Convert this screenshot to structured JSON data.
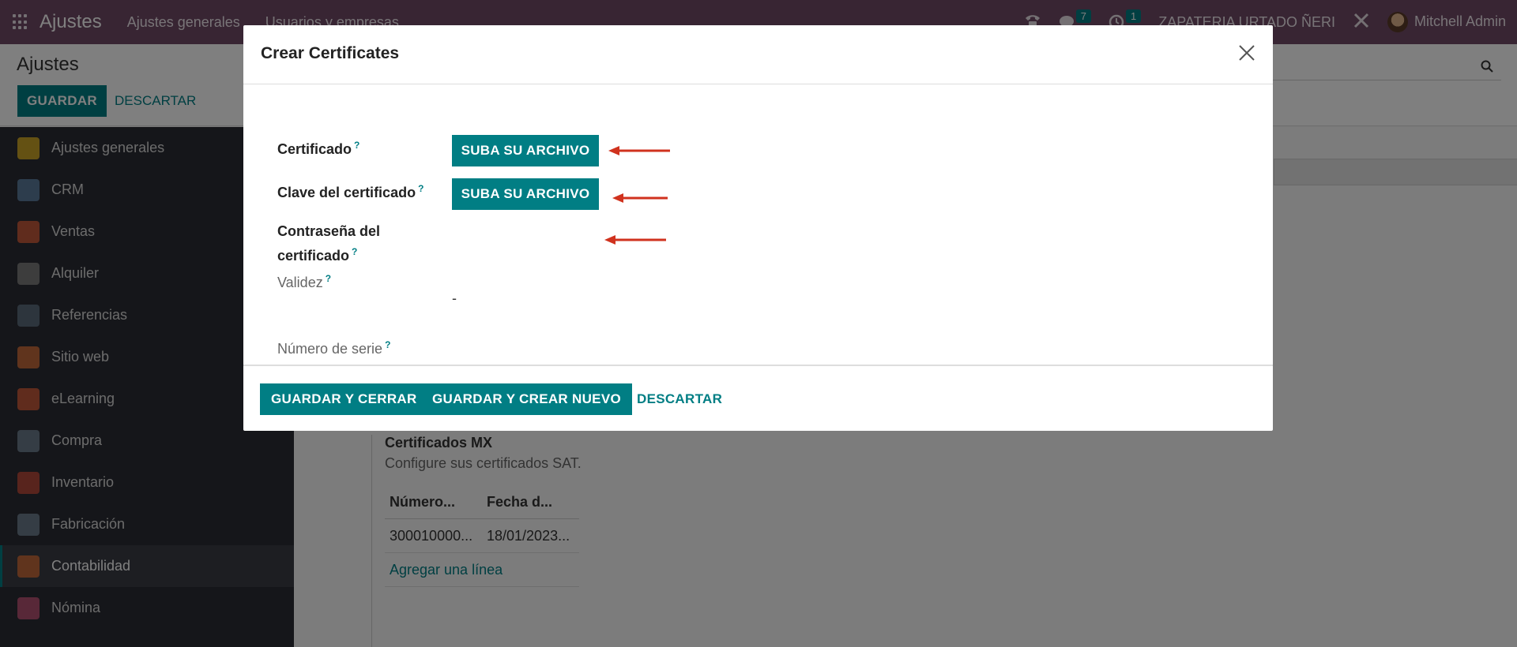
{
  "navbar": {
    "app_name": "Ajustes",
    "menu": [
      "Ajustes generales",
      "Usuarios y empresas"
    ],
    "messages_count": "7",
    "activities_count": "1",
    "company": "ZAPATERIA URTADO ÑERI",
    "user": "Mitchell Admin"
  },
  "control_panel": {
    "title": "Ajustes",
    "save_label": "GUARDAR",
    "discard_label": "DESCARTAR"
  },
  "sidebar": {
    "items": [
      {
        "label": "Ajustes generales",
        "icon": "gear-icon",
        "color": "#c9a227"
      },
      {
        "label": "CRM",
        "icon": "handshake-icon",
        "color": "#5a7a9a"
      },
      {
        "label": "Ventas",
        "icon": "chart-icon",
        "color": "#c0583a"
      },
      {
        "label": "Alquiler",
        "icon": "rental-icon",
        "color": "#7a7a7a"
      },
      {
        "label": "Referencias",
        "icon": "referral-icon",
        "color": "#5a6a7a"
      },
      {
        "label": "Sitio web",
        "icon": "globe-icon",
        "color": "#c0683a"
      },
      {
        "label": "eLearning",
        "icon": "elearning-icon",
        "color": "#c0583a"
      },
      {
        "label": "Compra",
        "icon": "purchase-icon",
        "color": "#6a7a8a"
      },
      {
        "label": "Inventario",
        "icon": "box-icon",
        "color": "#b0483a"
      },
      {
        "label": "Fabricación",
        "icon": "wrench-icon",
        "color": "#6a7a8a"
      },
      {
        "label": "Contabilidad",
        "icon": "invoice-icon",
        "color": "#c0683a"
      },
      {
        "label": "Nómina",
        "icon": "payroll-icon",
        "color": "#b05070"
      }
    ]
  },
  "main": {
    "section_title": "Certificados MX",
    "section_desc": "Configure sus certificados SAT.",
    "table_headers": [
      "Número...",
      "Fecha d..."
    ],
    "table_rows": [
      [
        "300010000...",
        "18/01/2023..."
      ]
    ],
    "add_line": "Agregar una línea"
  },
  "modal": {
    "title": "Crear Certificates",
    "fields": {
      "certificado": "Certificado",
      "clave": "Clave del certificado",
      "contrasena_l1": "Contraseña del",
      "contrasena_l2": "certificado",
      "validez": "Validez",
      "validez_value": "-",
      "numero_serie": "Número de serie"
    },
    "help_mark": "?",
    "upload_label": "SUBA SU ARCHIVO",
    "footer": {
      "save_close": "GUARDAR Y CERRAR",
      "save_new": "GUARDAR Y CREAR NUEVO",
      "discard": "DESCARTAR"
    }
  },
  "colors": {
    "brand": "#714b67",
    "accent": "#017e84",
    "arrow": "#d0321e"
  }
}
